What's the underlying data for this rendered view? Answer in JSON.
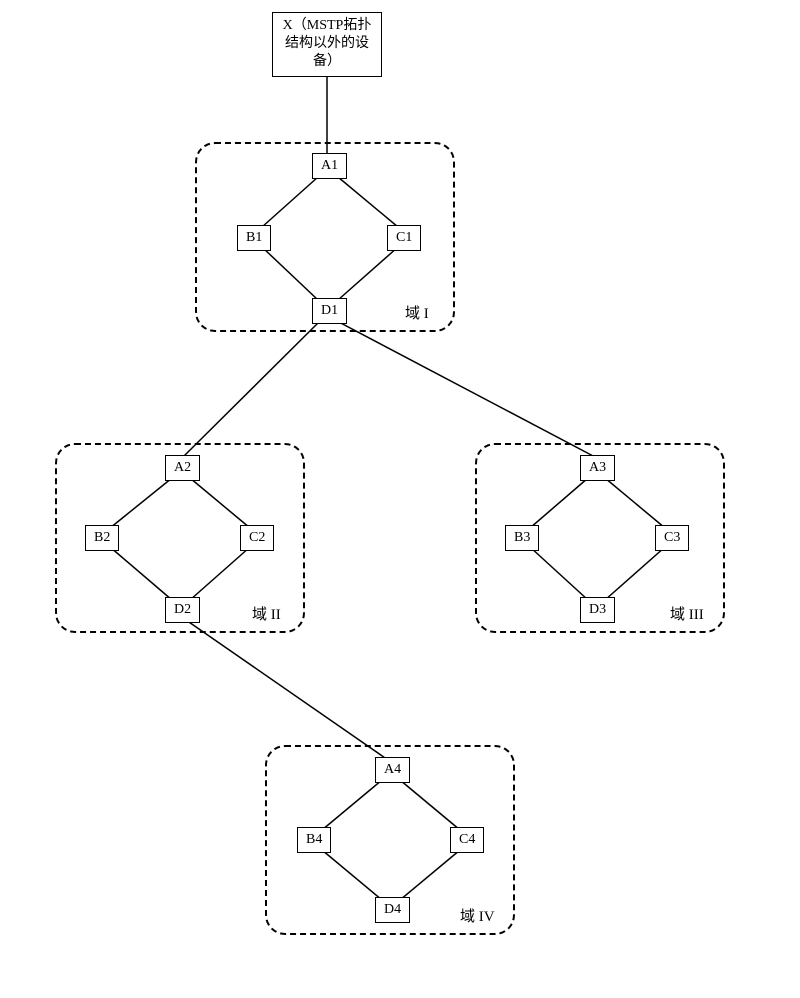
{
  "external": {
    "label": "X（MSTP拓扑结构以外的设备）"
  },
  "regions": {
    "r1": {
      "label": "域 I"
    },
    "r2": {
      "label": "域 II"
    },
    "r3": {
      "label": "域 III"
    },
    "r4": {
      "label": "域 IV"
    }
  },
  "nodes": {
    "a1": "A1",
    "b1": "B1",
    "c1": "C1",
    "d1": "D1",
    "a2": "A2",
    "b2": "B2",
    "c2": "C2",
    "d2": "D2",
    "a3": "A3",
    "b3": "B3",
    "c3": "C3",
    "d3": "D3",
    "a4": "A4",
    "b4": "B4",
    "c4": "C4",
    "d4": "D4"
  }
}
